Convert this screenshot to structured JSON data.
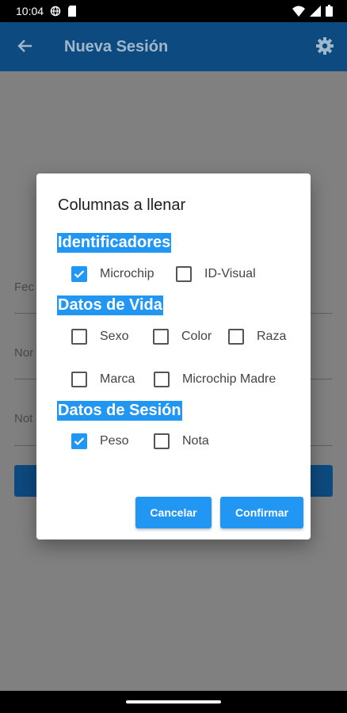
{
  "status_bar": {
    "time": "10:04"
  },
  "app_bar": {
    "title": "Nueva Sesión"
  },
  "background": {
    "fields": [
      "Fec",
      "Nor",
      "Not"
    ]
  },
  "dialog": {
    "title": "Columnas a llenar",
    "sections": [
      {
        "title": "Identificadores",
        "options": [
          {
            "label": "Microchip",
            "checked": true
          },
          {
            "label": "ID-Visual",
            "checked": false
          }
        ]
      },
      {
        "title": "Datos de Vida",
        "options": [
          {
            "label": "Sexo",
            "checked": false
          },
          {
            "label": "Color",
            "checked": false
          },
          {
            "label": "Raza",
            "checked": false
          },
          {
            "label": "Marca",
            "checked": false
          },
          {
            "label": "Microchip Madre",
            "checked": false
          }
        ]
      },
      {
        "title": "Datos de Sesión",
        "options": [
          {
            "label": "Peso",
            "checked": true
          },
          {
            "label": "Nota",
            "checked": false
          }
        ]
      }
    ],
    "cancel_label": "Cancelar",
    "confirm_label": "Confirmar"
  },
  "colors": {
    "primary": "#2196f3",
    "app_bar": "#1976d2"
  },
  "icons": {
    "back": "arrow-left-icon",
    "settings": "gear-icon"
  }
}
